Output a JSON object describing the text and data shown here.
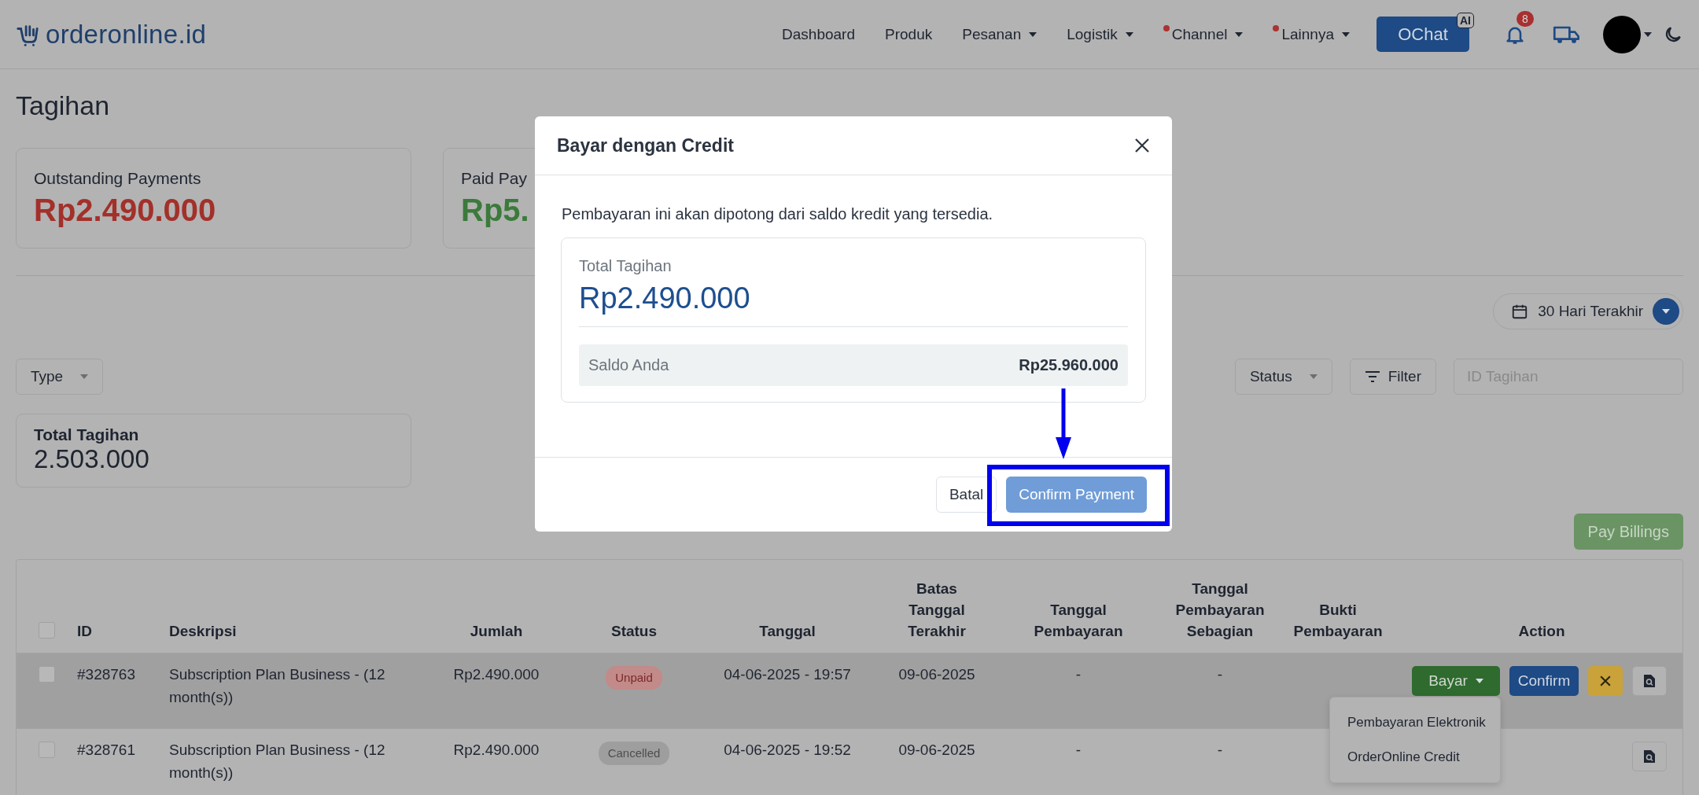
{
  "brand": {
    "name": "orderonline.id"
  },
  "nav": [
    {
      "label": "Dashboard",
      "caret": false,
      "dot": false
    },
    {
      "label": "Produk",
      "caret": false,
      "dot": false
    },
    {
      "label": "Pesanan",
      "caret": true,
      "dot": false
    },
    {
      "label": "Logistik",
      "caret": true,
      "dot": false
    },
    {
      "label": "Channel",
      "caret": true,
      "dot": true
    },
    {
      "label": "Lainnya",
      "caret": true,
      "dot": true
    }
  ],
  "ochat": {
    "label": "OChat",
    "badge": "AI"
  },
  "notifications": {
    "count": "8"
  },
  "page_title": "Tagihan",
  "summary_cards": [
    {
      "label": "Outstanding Payments",
      "value": "Rp2.490.000",
      "color": "#a3302a"
    },
    {
      "label": "Paid Pay",
      "value": "Rp5.",
      "color": "#3b7a3b"
    }
  ],
  "date_range": {
    "label": "30 Hari Terakhir"
  },
  "filters": {
    "type": "Type",
    "status": "Status",
    "filter": "Filter",
    "search_placeholder": "ID Tagihan"
  },
  "total_card": {
    "label": "Total Tagihan",
    "value": "2.503.000"
  },
  "pay_billings": "Pay Billings",
  "table": {
    "select_all": {
      "checked": false
    },
    "columns": [
      "ID",
      "Deskripsi",
      "Jumlah",
      "Status",
      "Tanggal",
      "Batas Tanggal Terakhir",
      "Tanggal Pembayaran",
      "Tanggal Pembayaran Sebagian",
      "Bukti Pembayaran",
      "Action"
    ],
    "rows": [
      {
        "checked": false,
        "highlighted": true,
        "id": "#328763",
        "description": "Subscription Plan Business - (12 month(s))",
        "amount": "Rp2.490.000",
        "status": {
          "label": "Unpaid",
          "kind": "unpaid"
        },
        "date": "04-06-2025 - 19:57",
        "due": "09-06-2025",
        "paid_date": "-",
        "partial_date": "-",
        "actions": [
          {
            "kind": "pay",
            "label": "Bayar"
          },
          {
            "kind": "confirm",
            "label": "Confirm"
          },
          {
            "kind": "cancel"
          },
          {
            "kind": "view"
          }
        ]
      },
      {
        "checked": false,
        "highlighted": false,
        "id": "#328761",
        "description": "Subscription Plan Business - (12 month(s))",
        "amount": "Rp2.490.000",
        "status": {
          "label": "Cancelled",
          "kind": "cancelled"
        },
        "date": "04-06-2025 - 19:52",
        "due": "09-06-2025",
        "paid_date": "-",
        "partial_date": "-",
        "actions": [
          {
            "kind": "view"
          }
        ]
      }
    ]
  },
  "action_menu": {
    "items": [
      "Pembayaran Elektronik",
      "OrderOnline Credit"
    ]
  },
  "modal": {
    "title": "Bayar dengan Credit",
    "message": "Pembayaran ini akan dipotong dari saldo kredit yang tersedia.",
    "total_label": "Total Tagihan",
    "total_value": "Rp2.490.000",
    "balance_label": "Saldo Anda",
    "balance_value": "Rp25.960.000",
    "cancel": "Batal",
    "confirm": "Confirm Payment"
  }
}
